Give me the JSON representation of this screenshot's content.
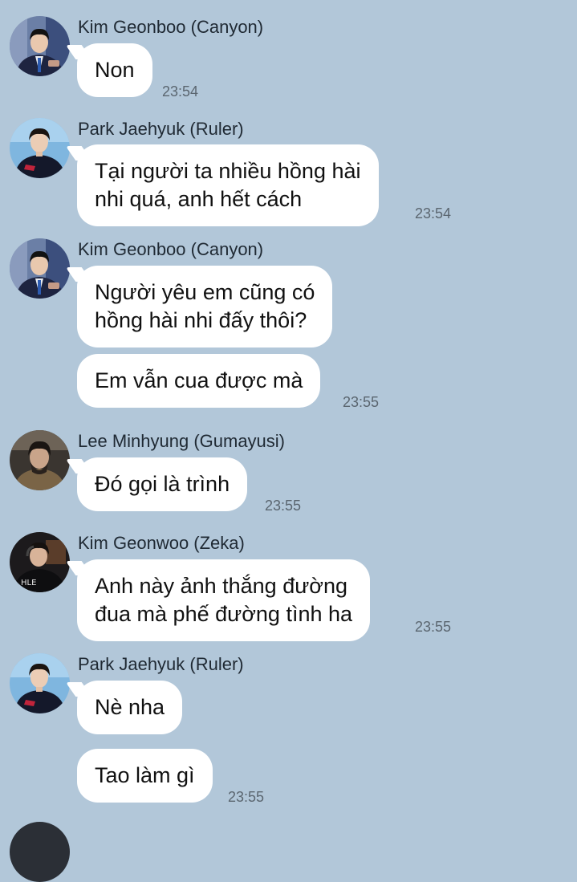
{
  "colors": {
    "background": "#b2c7d9",
    "bubble": "#ffffff",
    "timestamp": "#5b6670"
  },
  "messages": [
    {
      "sender": "Kim Geonboo (Canyon)",
      "avatar": "avatar-canyon",
      "bubbles": [
        "Non"
      ],
      "time": "23:54"
    },
    {
      "sender": "Park Jaehyuk (Ruler)",
      "avatar": "avatar-ruler",
      "bubbles": [
        "Tại người ta nhiều hồng hài\nnhi quá, anh hết cách"
      ],
      "time": "23:54"
    },
    {
      "sender": "Kim Geonboo (Canyon)",
      "avatar": "avatar-canyon",
      "bubbles": [
        "Người yêu em cũng có\nhồng hài nhi đấy thôi?",
        "Em vẫn cua được mà"
      ],
      "time": "23:55"
    },
    {
      "sender": "Lee Minhyung (Gumayusi)",
      "avatar": "avatar-gumayusi",
      "bubbles": [
        "Đó gọi là trình"
      ],
      "time": "23:55"
    },
    {
      "sender": "Kim Geonwoo (Zeka)",
      "avatar": "avatar-zeka",
      "bubbles": [
        "Anh này ảnh thắng đường\nđua mà phế đường tình ha"
      ],
      "time": "23:55"
    },
    {
      "sender": "Park Jaehyuk (Ruler)",
      "avatar": "avatar-ruler",
      "bubbles": [
        "Nè nha",
        "Tao làm gì"
      ],
      "time": "23:55"
    }
  ]
}
